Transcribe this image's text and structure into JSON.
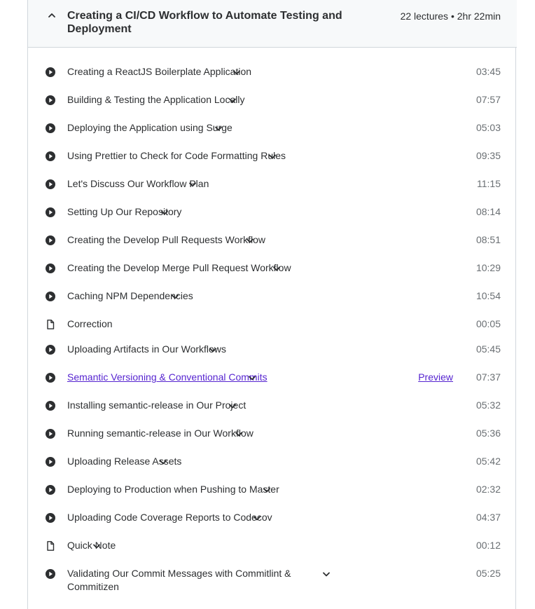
{
  "section": {
    "title": "Creating a CI/CD Workflow to Automate Testing and Deployment",
    "meta": "22 lectures • 2hr 22min",
    "collapse_icon": "chevron-up-icon"
  },
  "preview_label": "Preview",
  "lectures": [
    {
      "title": "Creating a ReactJS Boilerplate Application",
      "duration": "03:45",
      "type": "video"
    },
    {
      "title": "Building & Testing the Application Locally",
      "duration": "07:57",
      "type": "video"
    },
    {
      "title": "Deploying the Application using Surge",
      "duration": "05:03",
      "type": "video"
    },
    {
      "title": "Using Prettier to Check for Code Formatting Rules",
      "duration": "09:35",
      "type": "video"
    },
    {
      "title": "Let's Discuss Our Workflow Plan",
      "duration": "11:15",
      "type": "video"
    },
    {
      "title": "Setting Up Our Repository",
      "duration": "08:14",
      "type": "video"
    },
    {
      "title": "Creating the Develop Pull Requests Workflow",
      "duration": "08:51",
      "type": "video"
    },
    {
      "title": "Creating the Develop Merge Pull Request Workflow",
      "duration": "10:29",
      "type": "video"
    },
    {
      "title": "Caching NPM Dependencies",
      "duration": "10:54",
      "type": "video"
    },
    {
      "title": "Correction",
      "duration": "00:05",
      "type": "article"
    },
    {
      "title": "Uploading Artifacts in Our Workflows",
      "duration": "05:45",
      "type": "video"
    },
    {
      "title": "Semantic Versioning & Conventional Commits",
      "duration": "07:37",
      "type": "video",
      "preview": true
    },
    {
      "title": "Installing semantic-release in Our Project",
      "duration": "05:32",
      "type": "video"
    },
    {
      "title": "Running semantic-release in Our Workflow",
      "duration": "05:36",
      "type": "video"
    },
    {
      "title": "Uploading Release Assets",
      "duration": "05:42",
      "type": "video"
    },
    {
      "title": "Deploying to Production when Pushing to Master",
      "duration": "02:32",
      "type": "video"
    },
    {
      "title": "Uploading Code Coverage Reports to Codecov",
      "duration": "04:37",
      "type": "video"
    },
    {
      "title": "Quick Note",
      "duration": "00:12",
      "type": "article"
    },
    {
      "title": "Validating Our Commit Messages with Commitlint & Commitizen",
      "duration": "05:25",
      "type": "video"
    }
  ],
  "colors": {
    "link": "#5624d0",
    "text": "#2d2f31",
    "muted": "#6a6f73",
    "border": "#d1d7dc",
    "header_bg": "#f7f9fa"
  }
}
